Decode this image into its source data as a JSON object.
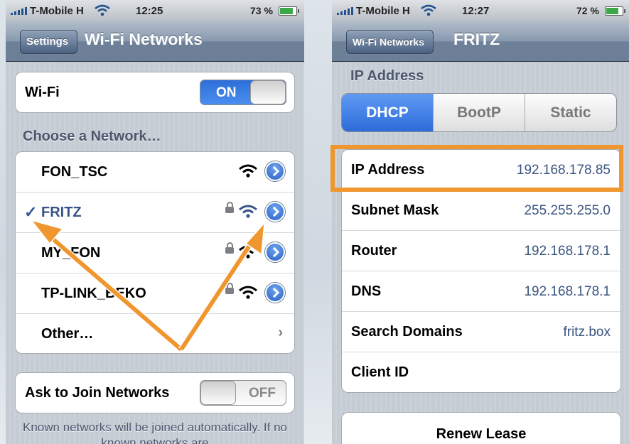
{
  "left": {
    "status": {
      "carrier": "T-Mobile H",
      "time": "12:25",
      "battery": "73 %",
      "battery_level": 0.73
    },
    "nav": {
      "back_label": "Settings",
      "title": "Wi-Fi Networks"
    },
    "wifi_row": {
      "label": "Wi-Fi",
      "toggle": "ON"
    },
    "section_header": "Choose a Network…",
    "networks": [
      {
        "name": "FON_TSC",
        "locked": false,
        "selected": false
      },
      {
        "name": "FRITZ",
        "locked": true,
        "selected": true,
        "check": "✓"
      },
      {
        "name": "MY_FON",
        "locked": true,
        "selected": false
      },
      {
        "name": "TP-LINK_BEKO",
        "locked": true,
        "selected": false
      }
    ],
    "other_row": {
      "label": "Other…",
      "chevron": "›"
    },
    "ask_row": {
      "label": "Ask to Join Networks",
      "toggle": "OFF"
    },
    "footer": "Known networks will be joined automatically.  If no known networks are"
  },
  "right": {
    "status": {
      "carrier": "T-Mobile H",
      "time": "12:27",
      "battery": "72 %",
      "battery_level": 0.72
    },
    "nav": {
      "back_label": "Wi-Fi Networks",
      "title": "FRITZ"
    },
    "section_header": "IP Address",
    "segments": [
      "DHCP",
      "BootP",
      "Static"
    ],
    "selected_segment": "DHCP",
    "fields": [
      {
        "label": "IP Address",
        "value": "192.168.178.85"
      },
      {
        "label": "Subnet Mask",
        "value": "255.255.255.0"
      },
      {
        "label": "Router",
        "value": "192.168.178.1"
      },
      {
        "label": "DNS",
        "value": "192.168.178.1"
      },
      {
        "label": "Search Domains",
        "value": "fritz.box"
      },
      {
        "label": "Client ID",
        "value": ""
      }
    ],
    "renew_button": "Renew Lease"
  },
  "colors": {
    "accent": "#2d6fd8",
    "annotation": "#f0962f",
    "value_text": "#3a557f"
  }
}
